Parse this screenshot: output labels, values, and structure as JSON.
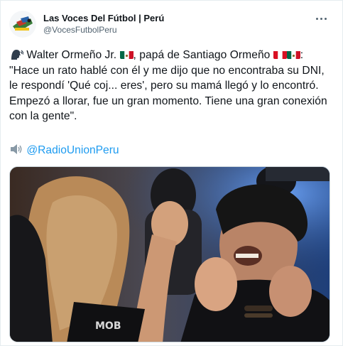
{
  "account": {
    "display_name": "Las Voces Del Fútbol | Perú",
    "handle": "@VocesFutbolPeru",
    "avatar_icon": "megaphone-logo-icon"
  },
  "menu": {
    "icon": "more-options-icon"
  },
  "tweet": {
    "speaker_emoji_icon": "speaking-head-icon",
    "name_text": " Walter Ormeño Jr. ",
    "middle_text": ", papá de Santiago Ormeño ",
    "quote_text": ": \"Hace un rato hablé con él y me dijo que no encontraba su DNI, le respondí 'Qué coj... eres', pero su mamá llegó y lo encontró. Empezó a llorar, fue un gran momento. Tiene una gran conexión con la gente\".",
    "flags": [
      "mexico-flag-icon",
      "peru-flag-icon",
      "mexico-flag-icon"
    ],
    "audio_icon": "speaker-icon",
    "mention": "@RadioUnionPeru"
  },
  "colors": {
    "link": "#1d9bf0",
    "text": "#0f1419",
    "secondary": "#536471",
    "border": "#cfd9de"
  },
  "media": {
    "alt_icon": "photo-crowd-embrace"
  }
}
